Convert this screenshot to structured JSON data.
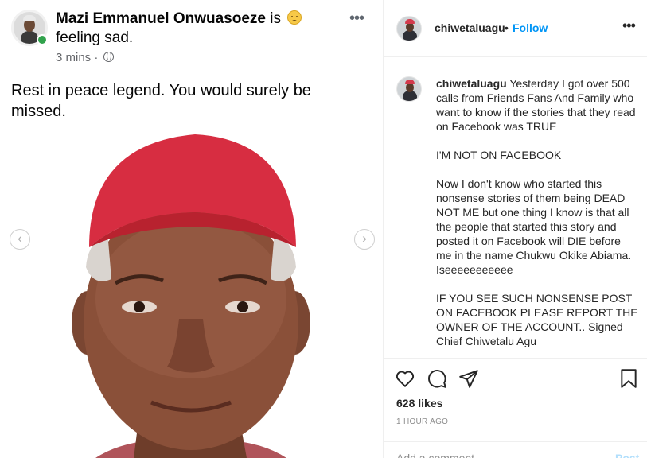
{
  "facebook_post": {
    "author": "Mazi Emmanuel Onwuasoeze",
    "status_prefix": "is",
    "status_feeling": "feeling sad.",
    "timestamp": "3 mins",
    "meta_separator": "·",
    "more_label": "•••",
    "text": "Rest in peace legend. You would surely be missed.",
    "prev_label": "‹",
    "next_label": "›"
  },
  "instagram": {
    "username": "chiwetaluagu",
    "dot": "•",
    "follow_label": "Follow",
    "more_label": "•••",
    "caption_username": "chiwetaluagu",
    "caption_paragraphs": [
      "Yesterday I got over 500 calls from Friends Fans And Family who want to know if the stories that they read on Facebook was TRUE",
      "I'M NOT ON FACEBOOK",
      "Now I don't know who started this nonsense stories of them being DEAD NOT ME but one thing I know is that all the people that started this story and posted it on Facebook will DIE before me in the name Chukwu Okike Abiama. Iseeeeeeeeeee",
      "IF YOU SEE SUCH NONSENSE POST ON FACEBOOK PLEASE REPORT THE OWNER OF THE ACCOUNT.. Signed Chief Chiwetalu Agu"
    ],
    "likes": "628 likes",
    "time_ago": "1 HOUR AGO",
    "comment_placeholder": "Add a comment...",
    "post_label": "Post"
  },
  "colors": {
    "follow_blue": "#0095f6",
    "post_disabled": "#b2dffc",
    "online_green": "#31a24c",
    "cap_red": "#d43a4c"
  },
  "icons": [
    "heart-icon",
    "comment-icon",
    "share-icon",
    "bookmark-icon",
    "globe-icon",
    "sad-emoji-icon",
    "chevron-left-icon",
    "chevron-right-icon"
  ]
}
